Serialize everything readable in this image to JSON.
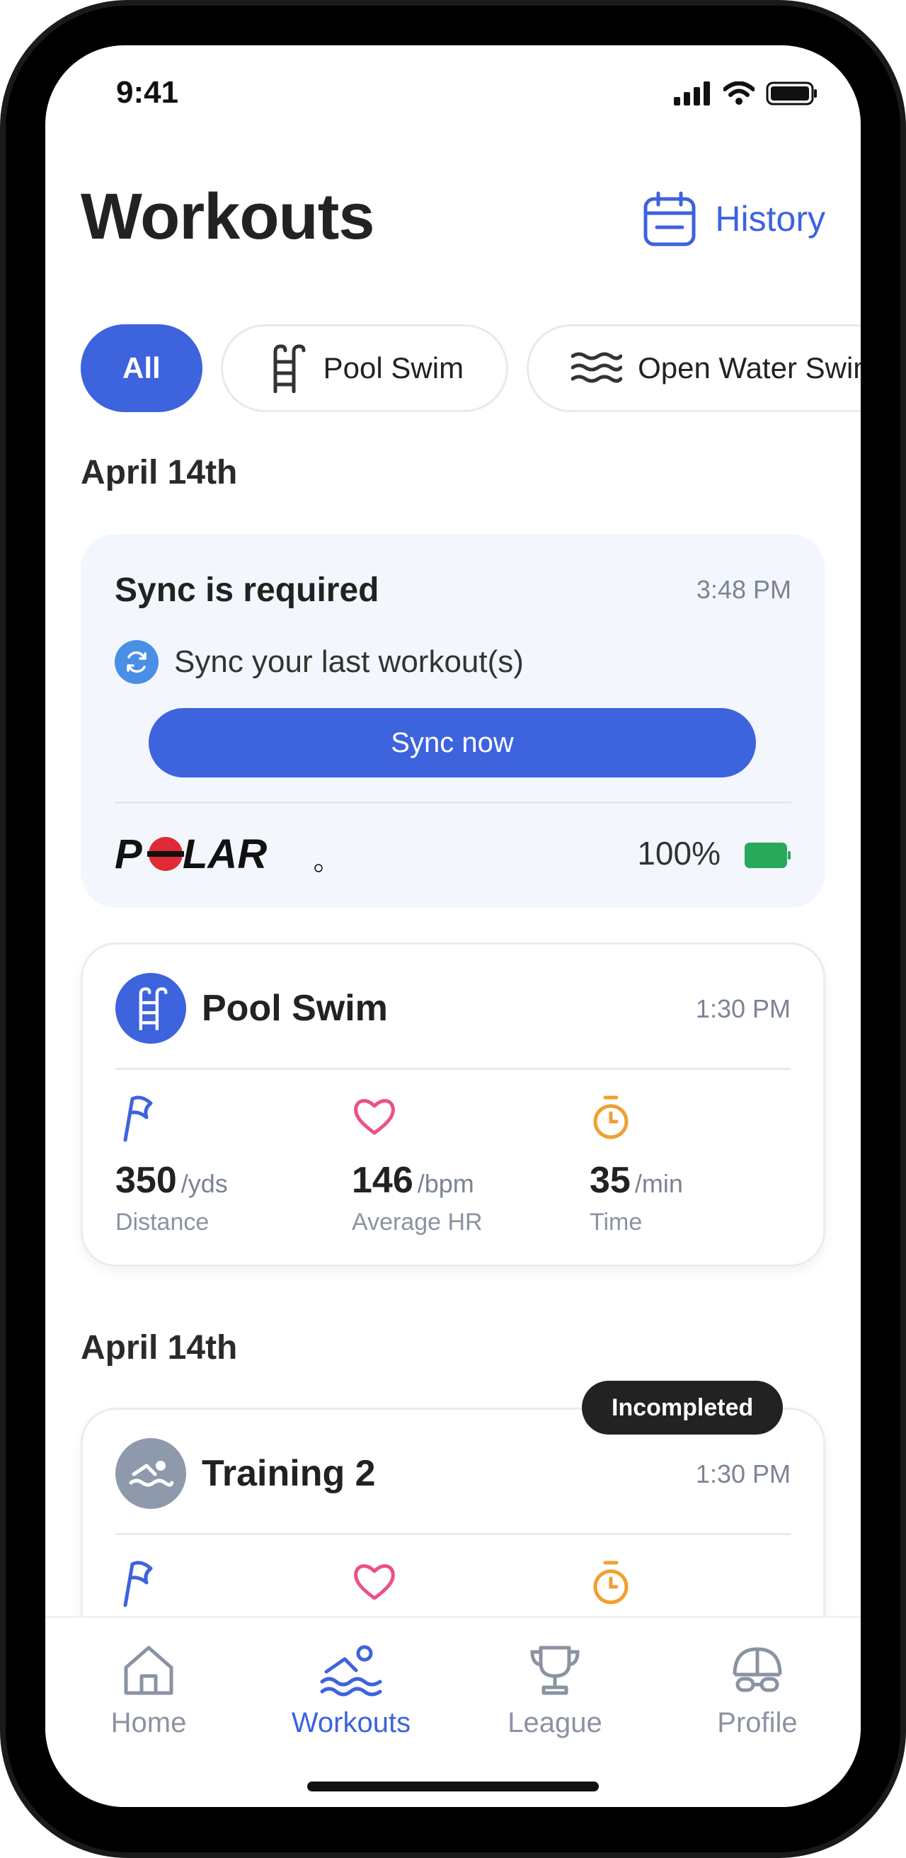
{
  "status_bar": {
    "time": "9:41"
  },
  "header": {
    "title": "Workouts",
    "history_label": "History"
  },
  "filters": [
    {
      "label": "All",
      "active": true
    },
    {
      "label": "Pool Swim",
      "icon": "pool-ladder-icon"
    },
    {
      "label": "Open Water Swim",
      "icon": "waves-icon"
    }
  ],
  "sections": [
    {
      "date": "April 14th"
    },
    {
      "date": "April 14th"
    }
  ],
  "sync_card": {
    "title": "Sync is required",
    "time": "3:48 PM",
    "message": "Sync your last workout(s)",
    "button_label": "Sync now",
    "brand": "POLAR",
    "battery": "100%",
    "battery_level": 1.0,
    "battery_color": "#27a85a"
  },
  "workouts": [
    {
      "title": "Pool Swim",
      "time": "1:30 PM",
      "icon": "pool-ladder-icon",
      "icon_color": "#3d63dd",
      "stats": [
        {
          "value": "350",
          "unit": "/yds",
          "label": "Distance",
          "icon": "flag-icon"
        },
        {
          "value": "146",
          "unit": "/bpm",
          "label": "Average HR",
          "icon": "heart-icon"
        },
        {
          "value": "35",
          "unit": "/min",
          "label": "Time",
          "icon": "stopwatch-icon"
        }
      ]
    },
    {
      "title": "Training 2",
      "time": "1:30 PM",
      "icon": "swimmer-icon",
      "icon_color": "#8e9aab",
      "badge": "Incompleted"
    }
  ],
  "tabs": [
    {
      "label": "Home",
      "icon": "home-icon"
    },
    {
      "label": "Workouts",
      "icon": "swim-icon",
      "active": true
    },
    {
      "label": "League",
      "icon": "trophy-icon"
    },
    {
      "label": "Profile",
      "icon": "swim-cap-icon"
    }
  ],
  "colors": {
    "accent": "#3d63dd",
    "heart": "#ec4f8b",
    "stopwatch": "#f0a030",
    "flag": "#3d63dd"
  }
}
